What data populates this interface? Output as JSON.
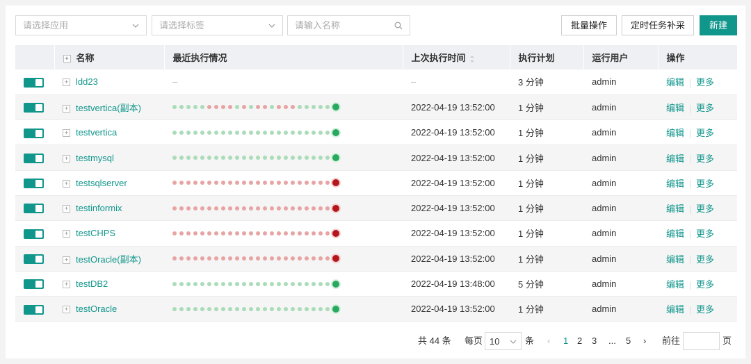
{
  "filters": {
    "app_placeholder": "请选择应用",
    "tag_placeholder": "请选择标签",
    "name_placeholder": "请输入名称"
  },
  "actions": {
    "batch": "批量操作",
    "backfill": "定时任务补采",
    "create": "新建"
  },
  "columns": [
    "名称",
    "最近执行情况",
    "上次执行时间",
    "执行计划",
    "运行用户",
    "操作"
  ],
  "rows": [
    {
      "name": "ldd23",
      "status": "",
      "time": "–",
      "plan": "3 分钟",
      "user": "admin",
      "empty": "–"
    },
    {
      "name": "testvertica(副本)",
      "status": "gggggrrrrgrgrrgrrrgggggG",
      "time": "2022-04-19 13:52:00",
      "plan": "1 分钟",
      "user": "admin"
    },
    {
      "name": "testvertica",
      "status": "gggggggggggggggggggggggG",
      "time": "2022-04-19 13:52:00",
      "plan": "1 分钟",
      "user": "admin"
    },
    {
      "name": "testmysql",
      "status": "gggggggggggggggggggggggG",
      "time": "2022-04-19 13:52:00",
      "plan": "1 分钟",
      "user": "admin"
    },
    {
      "name": "testsqlserver",
      "status": "rrrrrrrrrrrrrrrrrrrrrrrR",
      "time": "2022-04-19 13:52:00",
      "plan": "1 分钟",
      "user": "admin"
    },
    {
      "name": "testinformix",
      "status": "rrrrrrrrrrrrrrrrrrrrrrrR",
      "time": "2022-04-19 13:52:00",
      "plan": "1 分钟",
      "user": "admin"
    },
    {
      "name": "testCHPS",
      "status": "rrrrrrrrrrrrrrrrrrrrrrrR",
      "time": "2022-04-19 13:52:00",
      "plan": "1 分钟",
      "user": "admin"
    },
    {
      "name": "testOracle(副本)",
      "status": "rrrrrrrrrrrrrrrrrrrrrrrR",
      "time": "2022-04-19 13:52:00",
      "plan": "1 分钟",
      "user": "admin"
    },
    {
      "name": "testDB2",
      "status": "gggggggggggggggggggggggG",
      "time": "2022-04-19 13:48:00",
      "plan": "5 分钟",
      "user": "admin"
    },
    {
      "name": "testOracle",
      "status": "gggggggggggggggggggggggG",
      "time": "2022-04-19 13:52:00",
      "plan": "1 分钟",
      "user": "admin"
    }
  ],
  "row_actions": {
    "edit": "编辑",
    "more": "更多"
  },
  "pagination": {
    "total": "共 44 条",
    "per_page_label": "每页",
    "per_page_value": "10",
    "per_page_unit": "条",
    "pages": [
      "1",
      "2",
      "3",
      "...",
      "5"
    ],
    "current": "1",
    "goto_label": "前往",
    "goto_unit": "页"
  },
  "colors": {
    "accent": "#11968c",
    "success": "#27a95f",
    "failure": "#b4161b"
  }
}
